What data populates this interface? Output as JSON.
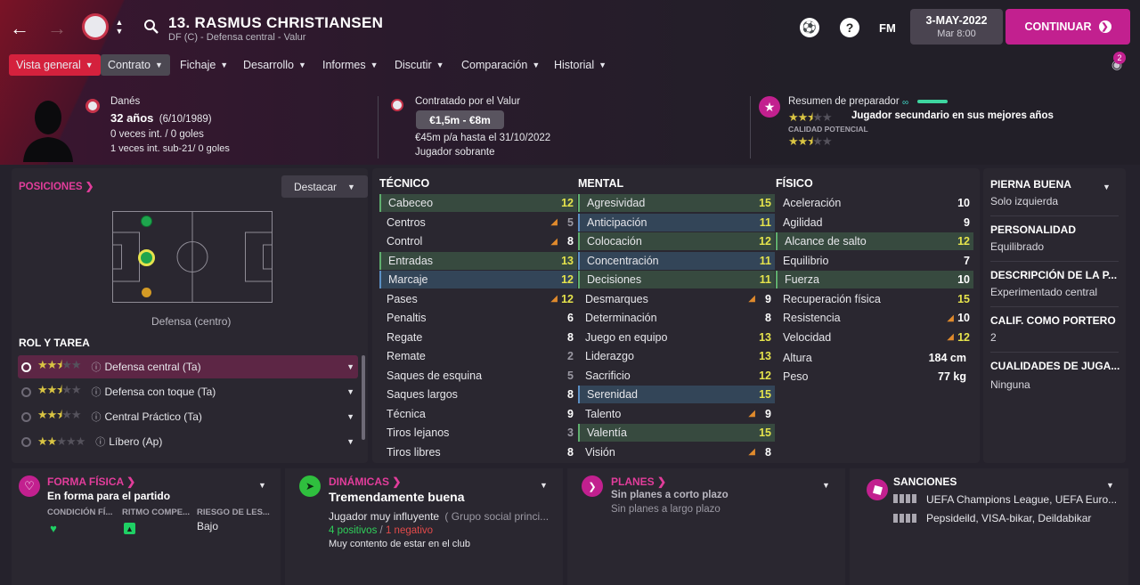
{
  "header": {
    "player_title": "13. RASMUS CHRISTIANSEN",
    "player_subtitle": "DF (C) - Defensa central - Valur",
    "fm_label": "FM",
    "date": "3-MAY-2022",
    "time": "Mar 8:00",
    "continue_label": "CONTINUAR",
    "notifications": "2"
  },
  "nav": {
    "items": [
      "Vista general",
      "Contrato",
      "Fichaje",
      "Desarrollo",
      "Informes",
      "Discutir",
      "Comparación",
      "Historial"
    ]
  },
  "bio": {
    "nationality": "Danés",
    "age": "32 años",
    "dob": "(6/10/1989)",
    "caps": "0 veces int. / 0 goles",
    "u21_caps": "1 veces int. sub-21/ 0 goles"
  },
  "contract": {
    "club_line": "Contratado por el Valur",
    "value_range": "€1,5m - €8m",
    "wage": "€45m p/a hasta el 31/10/2022",
    "status": "Jugador sobrante"
  },
  "coach_report": {
    "title": "Resumen de preparador",
    "summary": "Jugador secundario en sus mejores años",
    "potential_label": "CALIDAD POTENCIAL",
    "current_stars": 2.5,
    "potential_stars": 2.5
  },
  "positions": {
    "title": "POSICIONES",
    "highlight_label": "Destacar",
    "position_name": "Defensa (centro)"
  },
  "roles": {
    "title": "ROL Y TAREA",
    "items": [
      {
        "name": "Defensa central (Ta)",
        "stars": 2.5
      },
      {
        "name": "Defensa con toque (Ta)",
        "stars": 2.5
      },
      {
        "name": "Central Práctico (Ta)",
        "stars": 2.5
      },
      {
        "name": "Líbero (Ap)",
        "stars": 2
      }
    ]
  },
  "attributes": {
    "technical_title": "TÉCNICO",
    "mental_title": "MENTAL",
    "physical_title": "FÍSICO",
    "technical": [
      {
        "name": "Cabeceo",
        "value": "12",
        "hl": "green"
      },
      {
        "name": "Centros",
        "value": "5",
        "arrow": true
      },
      {
        "name": "Control",
        "value": "8",
        "arrow": true
      },
      {
        "name": "Entradas",
        "value": "13",
        "hl": "green"
      },
      {
        "name": "Marcaje",
        "value": "12",
        "hl": "blue"
      },
      {
        "name": "Pases",
        "value": "12",
        "arrow": true
      },
      {
        "name": "Penaltis",
        "value": "6"
      },
      {
        "name": "Regate",
        "value": "8"
      },
      {
        "name": "Remate",
        "value": "2"
      },
      {
        "name": "Saques de esquina",
        "value": "5"
      },
      {
        "name": "Saques largos",
        "value": "8"
      },
      {
        "name": "Técnica",
        "value": "9"
      },
      {
        "name": "Tiros lejanos",
        "value": "3"
      },
      {
        "name": "Tiros libres",
        "value": "8"
      }
    ],
    "mental": [
      {
        "name": "Agresividad",
        "value": "15",
        "hl": "green"
      },
      {
        "name": "Anticipación",
        "value": "11",
        "hl": "blue"
      },
      {
        "name": "Colocación",
        "value": "12",
        "hl": "green"
      },
      {
        "name": "Concentración",
        "value": "11",
        "hl": "blue"
      },
      {
        "name": "Decisiones",
        "value": "11",
        "hl": "green"
      },
      {
        "name": "Desmarques",
        "value": "9",
        "arrow": true
      },
      {
        "name": "Determinación",
        "value": "8"
      },
      {
        "name": "Juego en equipo",
        "value": "13"
      },
      {
        "name": "Liderazgo",
        "value": "13"
      },
      {
        "name": "Sacrificio",
        "value": "12"
      },
      {
        "name": "Serenidad",
        "value": "15",
        "hl": "blue"
      },
      {
        "name": "Talento",
        "value": "9",
        "arrow": true
      },
      {
        "name": "Valentía",
        "value": "15",
        "hl": "green"
      },
      {
        "name": "Visión",
        "value": "8",
        "arrow": true
      }
    ],
    "physical": [
      {
        "name": "Aceleración",
        "value": "10"
      },
      {
        "name": "Agilidad",
        "value": "9"
      },
      {
        "name": "Alcance de salto",
        "value": "12",
        "hl": "green"
      },
      {
        "name": "Equilibrio",
        "value": "7"
      },
      {
        "name": "Fuerza",
        "value": "10",
        "hl": "green"
      },
      {
        "name": "Recuperación física",
        "value": "15"
      },
      {
        "name": "Resistencia",
        "value": "10",
        "arrow": true
      },
      {
        "name": "Velocidad",
        "value": "12",
        "arrow": true
      }
    ],
    "height_label": "Altura",
    "height": "184 cm",
    "weight_label": "Peso",
    "weight": "77 kg"
  },
  "traits": [
    {
      "title": "PIERNA BUENA",
      "value": "Solo izquierda"
    },
    {
      "title": "PERSONALIDAD",
      "value": "Equilibrado"
    },
    {
      "title": "DESCRIPCIÓN DE LA P...",
      "value": "Experimentado central"
    },
    {
      "title": "CALIF. COMO PORTERO",
      "value": "2"
    },
    {
      "title": "CUALIDADES DE JUGA...",
      "value": "Ninguna"
    }
  ],
  "fitness": {
    "title": "FORMA FÍSICA",
    "status": "En forma para el partido",
    "col1": "CONDICIÓN FÍ...",
    "col2": "RITMO COMPE...",
    "col3": "RIESGO DE LES...",
    "risk": "Bajo"
  },
  "dynamics": {
    "title": "DINÁMICAS",
    "status": "Tremendamente buena",
    "influence": "Jugador muy influyente",
    "group": "( Grupo social princi...",
    "positives": "4 positivos",
    "slash": "/",
    "negatives": "1 negativo",
    "happiness": "Muy contento de estar en el club"
  },
  "plans": {
    "title": "PLANES",
    "short": "Sin planes a corto plazo",
    "long": "Sin planes a largo plazo"
  },
  "sanctions": {
    "title": "SANCIONES",
    "line1": "UEFA Champions League, UEFA Euro...",
    "line2": "Pepsideild, VISA-bikar, Deildabikar"
  },
  "colors": {
    "accent": "#c2208f",
    "nav_active": "#d4213d",
    "green_hl": "#374a3f",
    "blue_hl": "#334558",
    "star": "#d9c443"
  }
}
